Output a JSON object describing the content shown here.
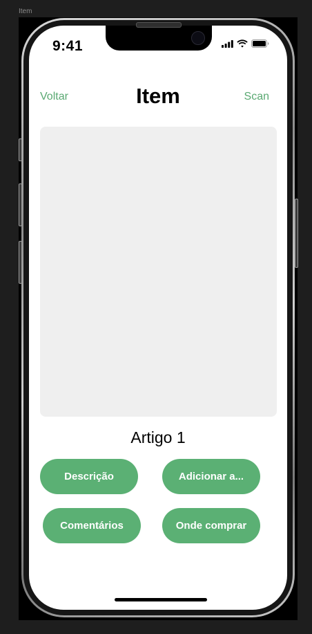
{
  "frame": {
    "label": "Item"
  },
  "status_bar": {
    "time": "9:41",
    "icons": [
      "signal-icon",
      "wifi-icon",
      "battery-icon"
    ]
  },
  "nav": {
    "back_label": "Voltar",
    "title": "Item",
    "scan_label": "Scan"
  },
  "item": {
    "name": "Artigo 1"
  },
  "actions": {
    "description": "Descrição",
    "add_to": "Adicionar a...",
    "comments": "Comentários",
    "where_to_buy": "Onde comprar"
  },
  "colors": {
    "accent": "#5aa972",
    "button": "#5bb074",
    "placeholder": "#efefef"
  }
}
